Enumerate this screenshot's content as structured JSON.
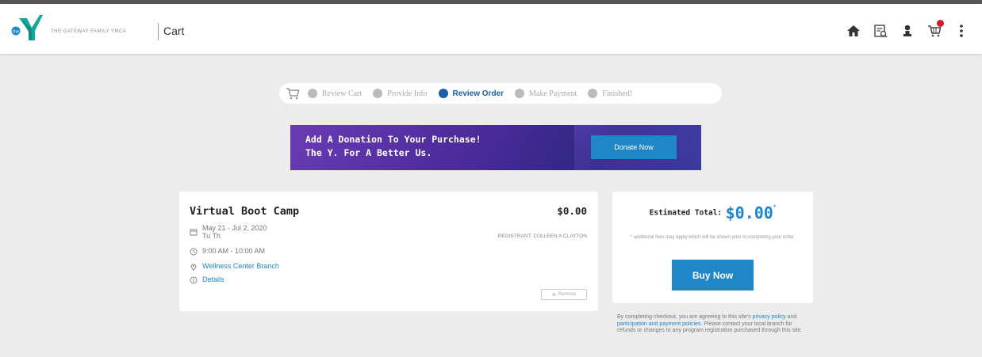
{
  "header": {
    "org_name": "THE GATEWAY FAMILY YMCA",
    "page_name": "Cart",
    "logo_text": "the",
    "icons": [
      "home-icon",
      "schedule-icon",
      "account-icon",
      "cart-icon",
      "more-icon"
    ],
    "cart_badge_color": "#d7192d"
  },
  "steps": {
    "items": [
      {
        "label": "Review Cart",
        "active": false
      },
      {
        "label": "Provide Info",
        "active": false
      },
      {
        "label": "Review Order",
        "active": true
      },
      {
        "label": "Make Payment",
        "active": false
      },
      {
        "label": "Finished!",
        "active": false
      }
    ]
  },
  "banner": {
    "line1": "Add A Donation To Your Purchase!",
    "line2": "The Y. For A Better Us.",
    "button_label": "Donate Now"
  },
  "item": {
    "title": "Virtual Boot Camp",
    "price": "$0.00",
    "dates": "May 21 - Jul 2, 2020",
    "days": "Tu Th",
    "time": "9:00 AM - 10:00 AM",
    "location": "Wellness Center Branch",
    "details_label": "Details",
    "registrant": "REGISTRANT: Colleen A Clayton",
    "remove_label": "Remove"
  },
  "summary": {
    "estimated_label": "Estimated Total:",
    "estimated_value": "$0.00",
    "asterisk": "*",
    "note": "* additional fees may apply which will be shown prior to completing your order.",
    "buy_label": "Buy Now"
  },
  "terms": {
    "text1": "By completing checkout, you are agreeing to this site's",
    "privacy_link": "privacy policy",
    "and": "and",
    "payment_link": "participation and payment policies",
    "text2": ". Please contact your local branch for refunds or changes to any program registration purchased through this site."
  },
  "colors": {
    "accent": "#1c86d0",
    "button": "#1f86c8",
    "active_step": "#1c5fa8",
    "background": "#ececec"
  }
}
